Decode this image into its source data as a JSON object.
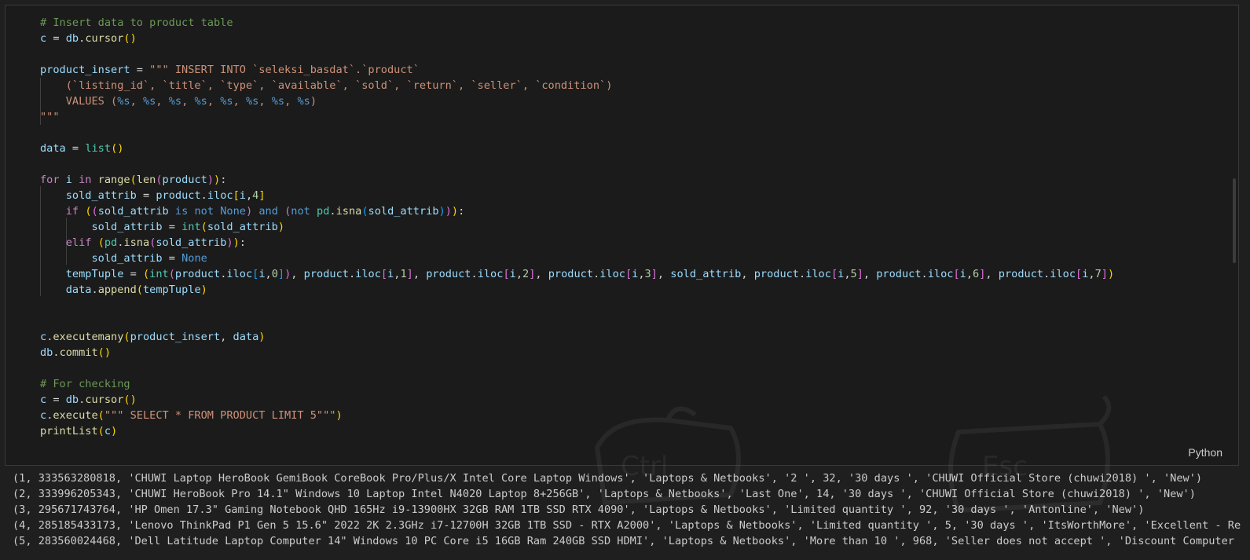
{
  "cell": {
    "language": "Python",
    "comment_insert": "# Insert data to product table",
    "comment_check": "# For checking",
    "sql_insert": "\"\"\" INSERT INTO `seleksi_basdat`.`product`",
    "sql_columns": "(`listing_id`, `title`, `type`, `available`, `sold`, `return`, `seller`, `condition`)",
    "sql_values": "VALUES (",
    "sql_close": "\"\"\"",
    "sql_select": "\"\"\" SELECT * FROM PRODUCT LIMIT 5\"\"\""
  },
  "output": {
    "lines": [
      "(1, 333563280818, 'CHUWI Laptop HeroBook GemiBook CoreBook Pro/Plus/X Intel Core Laptop Windows', 'Laptops & Netbooks', '2 ', 32, '30 days ', 'CHUWI Official Store (chuwi2018) ', 'New')",
      "(2, 333996205343, 'CHUWI HeroBook Pro 14.1\" Windows 10 Laptop Intel N4020 Laptop 8+256GB', 'Laptops & Netbooks', 'Last One', 14, '30 days ', 'CHUWI Official Store (chuwi2018) ', 'New')",
      "(3, 295671743764, 'HP Omen 17.3\" Gaming Notebook QHD 165Hz i9-13900HX 32GB RAM 1TB SSD RTX 4090', 'Laptops & Netbooks', 'Limited quantity ', 92, '30 days ', 'Antonline', 'New')",
      "(4, 285185433173, 'Lenovo ThinkPad P1 Gen 5 15.6\" 2022 2K 2.3GHz i7-12700H 32GB 1TB SSD - RTX A2000', 'Laptops & Netbooks', 'Limited quantity ', 5, '30 days ', 'ItsWorthMore', 'Excellent - Refurbished')",
      "(5, 283560024468, 'Dell Latitude Laptop Computer 14\" Windows 10 PC Core i5 16GB Ram 240GB SSD HDMI', 'Laptops & Netbooks', 'More than 10 ', 968, 'Seller does not accept ', 'Discount Computer Depot')"
    ]
  },
  "colors": {
    "background": "#1f1f1f",
    "comment": "#6a9955",
    "string": "#ce9178",
    "keyword": "#c586c0",
    "variable": "#9cdcfe",
    "function": "#dcdcaa"
  },
  "watermark": {
    "keys": [
      "Ctrl",
      "Esc"
    ]
  }
}
